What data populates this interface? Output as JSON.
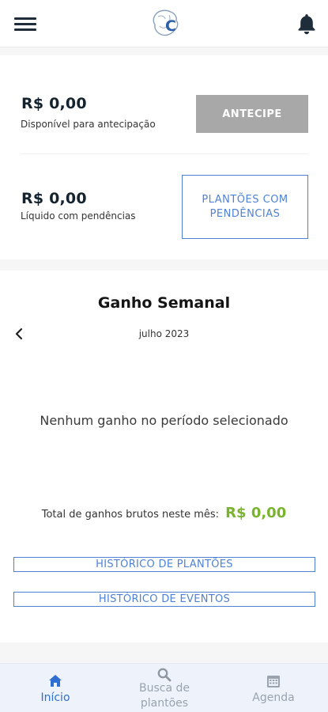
{
  "header": {
    "menu_icon": "hamburger-menu-icon",
    "logo_letter": "C",
    "notification_icon": "bell-icon"
  },
  "balance": {
    "available_amount": "R$ 0,00",
    "available_caption": "Disponível para antecipação",
    "anticipate_label": "ANTECIPE",
    "pending_amount": "R$ 0,00",
    "pending_caption": "Líquido com pendências",
    "pending_button_label": "PLANTÕES COM PENDÊNCIAS"
  },
  "weekly": {
    "title": "Ganho Semanal",
    "month": "julho 2023",
    "empty_message": "Nenhum ganho no período selecionado",
    "total_label": "Total de ganhos brutos neste mês:",
    "total_value": "R$ 0,00",
    "history_shifts_label": "HISTÓRICO DE PLANTÕES",
    "history_events_label": "HISTÓRICO DE EVENTOS"
  },
  "nav": {
    "items": [
      {
        "label": "Início",
        "icon": "home-icon",
        "active": true
      },
      {
        "label": "Busca de plantões",
        "icon": "search-icon",
        "active": false
      },
      {
        "label": "Agenda",
        "icon": "calendar-icon",
        "active": false
      }
    ]
  },
  "colors": {
    "accent": "#4f82d4",
    "active_nav": "#2f6fd1",
    "disabled_button": "#a8a8a8",
    "positive_value": "#7ab32e",
    "nav_background": "#eef3fb"
  }
}
